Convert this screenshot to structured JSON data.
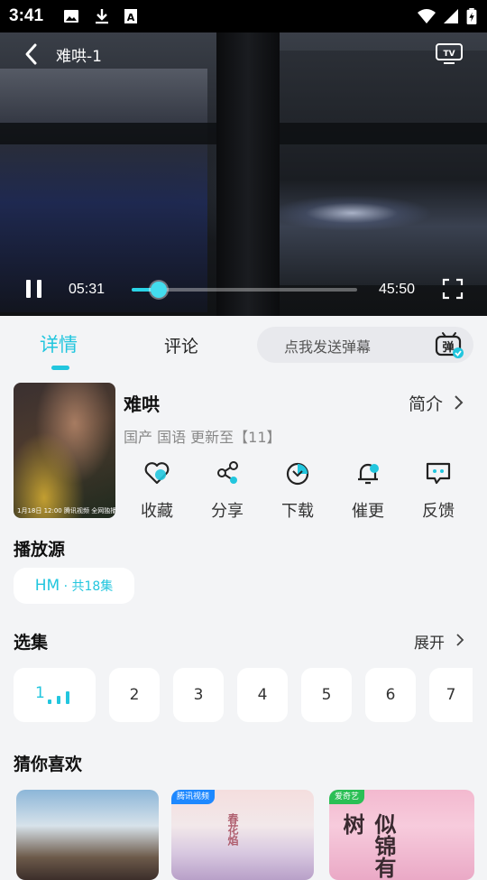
{
  "status_bar": {
    "time": "3:41"
  },
  "player": {
    "title": "难哄-1",
    "current_time": "05:31",
    "duration": "45:50",
    "progress": 0.12
  },
  "tabs": {
    "details": "详情",
    "comments": "评论"
  },
  "danmaku": {
    "placeholder": "点我发送弹幕",
    "icon_text": "弹"
  },
  "show": {
    "name": "难哄",
    "meta": "国产 国语 更新至【11】",
    "intro_label": "简介",
    "poster_caption": "1月18日 12:00 腾讯视频 全网独播"
  },
  "actions": [
    {
      "label": "收藏",
      "icon": "heart-icon"
    },
    {
      "label": "分享",
      "icon": "share-icon"
    },
    {
      "label": "下载",
      "icon": "download-icon"
    },
    {
      "label": "催更",
      "icon": "bell-icon"
    },
    {
      "label": "反馈",
      "icon": "feedback-icon"
    }
  ],
  "source": {
    "title": "播放源",
    "name": "HM",
    "count": " · 共18集"
  },
  "episodes": {
    "title": "选集",
    "expand_label": "展开",
    "items": [
      "1",
      "2",
      "3",
      "4",
      "5",
      "6",
      "7"
    ],
    "playing_index": 0
  },
  "recommend": {
    "title": "猜你喜欢",
    "items": [
      {
        "badge": "",
        "art_text": ""
      },
      {
        "badge": "腾讯视频",
        "art_text": "春花焰"
      },
      {
        "badge": "爱奇艺",
        "art_text": "似锦有树"
      }
    ]
  },
  "colors": {
    "accent": "#22c6de",
    "background": "#f3f4f6"
  }
}
